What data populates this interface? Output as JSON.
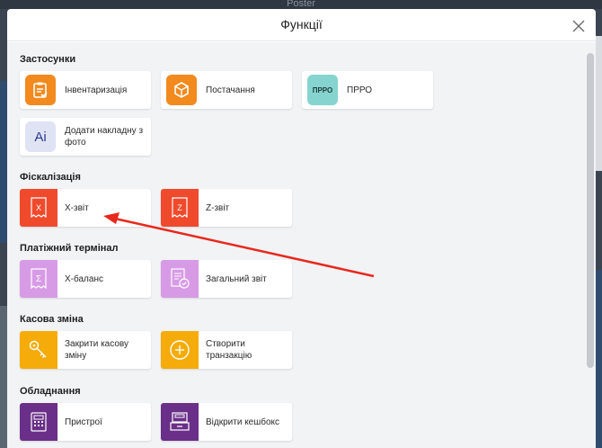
{
  "background": {
    "app_title": "Poster"
  },
  "modal": {
    "title": "Функції"
  },
  "sections": [
    {
      "title": "Застосунки",
      "items": [
        {
          "label": "Інвентаризація",
          "icon": "clipboard-check-icon",
          "color": "#f28a1e"
        },
        {
          "label": "Постачання",
          "icon": "box-icon",
          "color": "#f28a1e"
        },
        {
          "label": "ПРРО",
          "icon": "prro-badge-icon",
          "color": "#86d4cf",
          "badge_text": "ПРРО"
        },
        {
          "label": "Додати накладну з фото",
          "icon": "ai-icon",
          "color": "#dfe3f3",
          "badge_text": "Ai"
        }
      ]
    },
    {
      "title": "Фіскалізація",
      "items": [
        {
          "label": "X-звіт",
          "icon": "receipt-x-icon",
          "color": "#f04a2d",
          "badge_text": "X"
        },
        {
          "label": "Z-звіт",
          "icon": "receipt-z-icon",
          "color": "#f04a2d",
          "badge_text": "Z"
        }
      ]
    },
    {
      "title": "Платіжний термінал",
      "items": [
        {
          "label": "Х-баланс",
          "icon": "receipt-sigma-icon",
          "color": "#d79be6",
          "badge_text": "Σ"
        },
        {
          "label": "Загальний звіт",
          "icon": "report-check-icon",
          "color": "#d79be6"
        }
      ]
    },
    {
      "title": "Касова зміна",
      "items": [
        {
          "label": "Закрити касову зміну",
          "icon": "key-icon",
          "color": "#f5ac0a"
        },
        {
          "label": "Створити транзакцію",
          "icon": "plus-circle-icon",
          "color": "#f5ac0a"
        }
      ]
    },
    {
      "title": "Обладнання",
      "items": [
        {
          "label": "Пристрої",
          "icon": "calculator-icon",
          "color": "#6a2f88"
        },
        {
          "label": "Відкрити кешбокс",
          "icon": "cashbox-icon",
          "color": "#6a2f88"
        }
      ]
    }
  ],
  "annotation": {
    "arrow_color": "#e8281c"
  }
}
